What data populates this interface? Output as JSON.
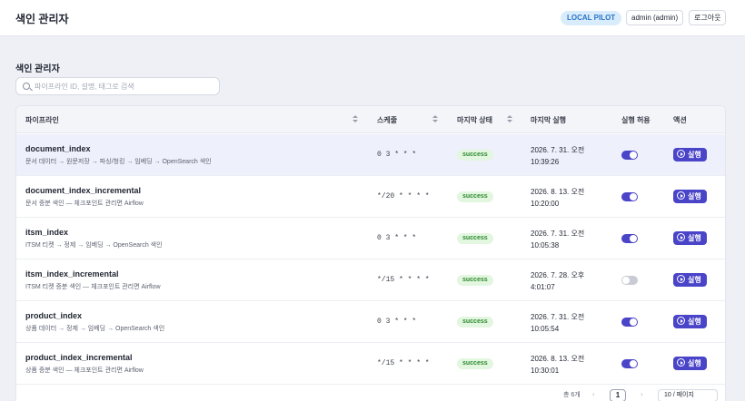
{
  "header": {
    "title": "색인 관리자",
    "env_badge": "LOCAL PILOT",
    "user": "admin (admin)",
    "logout_label": "로그아웃"
  },
  "page": {
    "section_title": "색인 관리자",
    "search_placeholder": "파이프라인 ID, 설명, 태그로 검색"
  },
  "table": {
    "columns": [
      "파이프라인",
      "스케줄",
      "마지막 상태",
      "마지막 실행",
      "실행 허용",
      "액션"
    ],
    "rows": [
      {
        "name": "document_index",
        "description": "문서 데이터 → 원문저장 → 파싱/청킹 → 임베딩 → OpenSearch 색인",
        "schedule": "0 3 * * *",
        "status": "success",
        "last_run_date": "2026. 7. 31. 오전",
        "last_run_time": "10:39:26",
        "enabled": true,
        "selected": true
      },
      {
        "name": "document_index_incremental",
        "description": "문서 증분 색인 — 체크포인트 관리면 Airflow",
        "schedule": "*/20 * * * *",
        "status": "success",
        "last_run_date": "2026. 8. 13. 오전",
        "last_run_time": "10:20:00",
        "enabled": true,
        "selected": false
      },
      {
        "name": "itsm_index",
        "description": "ITSM 티켓 → 정제 → 임베딩 → OpenSearch 색인",
        "schedule": "0 3 * * *",
        "status": "success",
        "last_run_date": "2026. 7. 31. 오전",
        "last_run_time": "10:05:38",
        "enabled": true,
        "selected": false
      },
      {
        "name": "itsm_index_incremental",
        "description": "ITSM 티켓 증분 색인 — 체크포인트 관리면 Airflow",
        "schedule": "*/15 * * * *",
        "status": "success",
        "last_run_date": "2026. 7. 28. 오후",
        "last_run_time": "4:01:07",
        "enabled": false,
        "selected": false
      },
      {
        "name": "product_index",
        "description": "상품 데이터 → 정제 → 임베딩 → OpenSearch 색인",
        "schedule": "0 3 * * *",
        "status": "success",
        "last_run_date": "2026. 7. 31. 오전",
        "last_run_time": "10:05:54",
        "enabled": true,
        "selected": false
      },
      {
        "name": "product_index_incremental",
        "description": "상품 증분 색인 — 체크포인트 관리면 Airflow",
        "schedule": "*/15 * * * *",
        "status": "success",
        "last_run_date": "2026. 8. 13. 오전",
        "last_run_time": "10:30:01",
        "enabled": true,
        "selected": false
      }
    ],
    "run_label": "실행",
    "status_color": "#2e8a30",
    "accent_color": "#4a44c8"
  },
  "pagination": {
    "summary": "총 6개",
    "prev": "‹",
    "current_page": "1",
    "next": "›",
    "page_size": "10 / 페이지"
  }
}
